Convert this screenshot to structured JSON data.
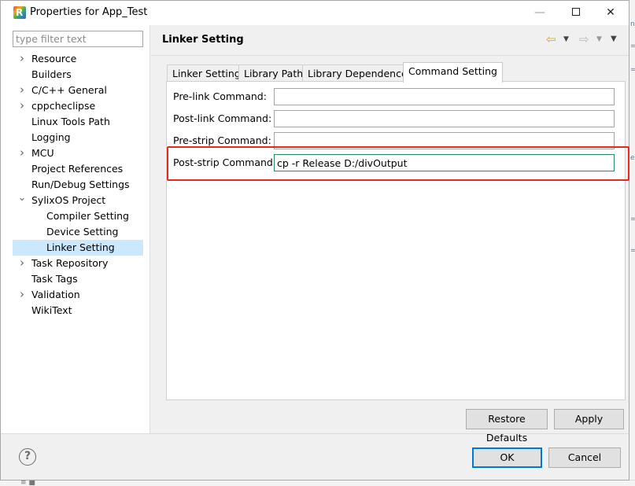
{
  "window": {
    "title": "Properties for App_Test",
    "controls": {
      "minimize": "—",
      "close": "✕"
    }
  },
  "sidebar": {
    "filter_placeholder": "type filter text",
    "items": [
      {
        "label": "Resource",
        "expandable": true,
        "level": 0
      },
      {
        "label": "Builders",
        "expandable": false,
        "level": 0
      },
      {
        "label": "C/C++ General",
        "expandable": true,
        "level": 0
      },
      {
        "label": "cppcheclipse",
        "expandable": true,
        "level": 0
      },
      {
        "label": "Linux Tools Path",
        "expandable": false,
        "level": 0
      },
      {
        "label": "Logging",
        "expandable": false,
        "level": 0
      },
      {
        "label": "MCU",
        "expandable": true,
        "level": 0
      },
      {
        "label": "Project References",
        "expandable": false,
        "level": 0
      },
      {
        "label": "Run/Debug Settings",
        "expandable": false,
        "level": 0
      },
      {
        "label": "SylixOS Project",
        "expandable": true,
        "expanded": true,
        "level": 0
      },
      {
        "label": "Compiler Setting",
        "expandable": false,
        "level": 1
      },
      {
        "label": "Device Setting",
        "expandable": false,
        "level": 1
      },
      {
        "label": "Linker Setting",
        "expandable": false,
        "level": 1,
        "selected": true
      },
      {
        "label": "Task Repository",
        "expandable": true,
        "level": 0
      },
      {
        "label": "Task Tags",
        "expandable": false,
        "level": 0
      },
      {
        "label": "Validation",
        "expandable": true,
        "level": 0
      },
      {
        "label": "WikiText",
        "expandable": false,
        "level": 0
      }
    ]
  },
  "page": {
    "title": "Linker Setting",
    "tabs": [
      {
        "label": "Linker Setting",
        "active": false
      },
      {
        "label": "Library Path",
        "active": false
      },
      {
        "label": "Library Dependence",
        "active": false
      },
      {
        "label": "Command Setting",
        "active": true
      }
    ],
    "fields": [
      {
        "label": "Pre-link Command:",
        "value": ""
      },
      {
        "label": "Post-link Command:",
        "value": ""
      },
      {
        "label": "Pre-strip Command:",
        "value": ""
      },
      {
        "label": "Post-strip Command:",
        "value": "cp -r Release D:/divOutput"
      }
    ],
    "restore_defaults": "Restore Defaults",
    "apply": "Apply"
  },
  "footer": {
    "help": "?",
    "ok": "OK",
    "cancel": "Cancel"
  },
  "colors": {
    "selection": "#cce8ff",
    "highlight": "#e8271f",
    "default_button_border": "#0078d7"
  }
}
